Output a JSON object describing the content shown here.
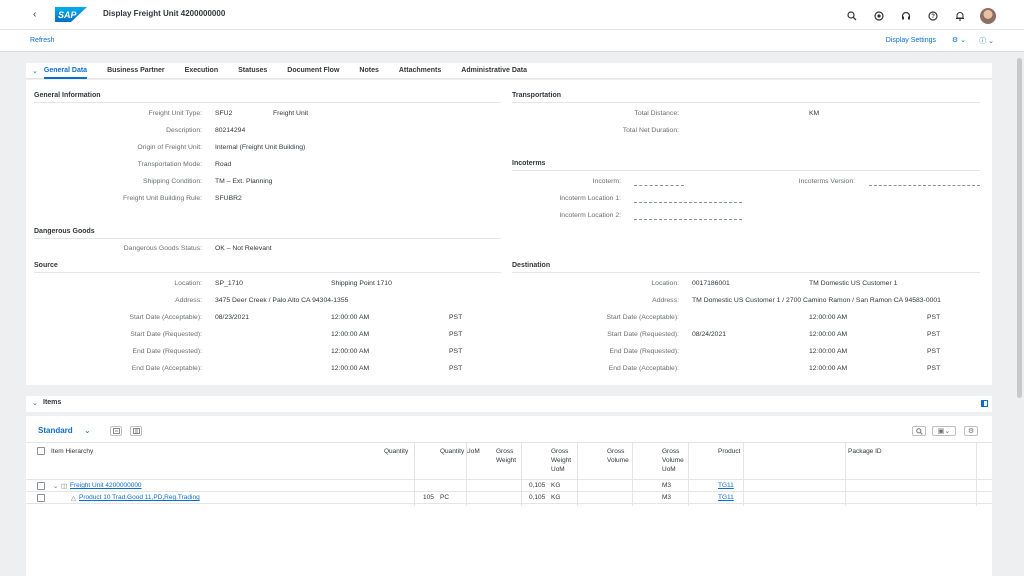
{
  "shell": {
    "title": "Display Freight Unit 4200000000",
    "logo": "SAP",
    "back_icon": "back-icon"
  },
  "subbar": {
    "refresh": "Refresh",
    "display_settings": "Display Settings"
  },
  "tabs": [
    "General Data",
    "Business Partner",
    "Execution",
    "Statuses",
    "Document Flow",
    "Notes",
    "Attachments",
    "Administrative Data"
  ],
  "general": {
    "title": "General Information",
    "rows": [
      {
        "label": "Freight Unit Type:",
        "value": "SFU2",
        "extra": "Freight Unit"
      },
      {
        "label": "Description:",
        "value": "80214294",
        "extra": ""
      },
      {
        "label": "Origin of Freight Unit:",
        "value": "Internal (Freight Unit Building)",
        "extra": ""
      },
      {
        "label": "Transportation Mode:",
        "value": "Road",
        "extra": ""
      },
      {
        "label": "Shipping Condition:",
        "value": "TM – Ext. Planning",
        "extra": ""
      },
      {
        "label": "Freight Unit Building Rule:",
        "value": "SFUBR2",
        "extra": ""
      }
    ]
  },
  "transportation": {
    "title": "Transportation",
    "distance_label": "Total Distance:",
    "distance_unit": "KM",
    "duration_label": "Total Net Duration:"
  },
  "incoterms": {
    "title": "Incoterms",
    "incoterm": "Incoterm:",
    "version": "Incoterms Version:",
    "loc1": "Incoterm Location 1:",
    "loc2": "Incoterm Location 2:"
  },
  "dangerous": {
    "title": "Dangerous Goods",
    "label": "Dangerous Goods Status:",
    "value": "OK – Not Relevant"
  },
  "source": {
    "title": "Source",
    "location_label": "Location:",
    "location": "SP_1710",
    "location_name": "Shipping Point 1710",
    "address_label": "Address:",
    "address": "3475 Deer Creek / Palo Alto CA 94304-1355",
    "dates": [
      {
        "label": "Start Date (Acceptable):",
        "date": "08/23/2021",
        "time": "12:00:00 AM",
        "tz": "PST"
      },
      {
        "label": "Start Date (Requested):",
        "date": "",
        "time": "12:00:00 AM",
        "tz": "PST"
      },
      {
        "label": "End Date (Requested):",
        "date": "",
        "time": "12:00:00 AM",
        "tz": "PST"
      },
      {
        "label": "End Date (Acceptable):",
        "date": "",
        "time": "12:00:00 AM",
        "tz": "PST"
      }
    ]
  },
  "destination": {
    "title": "Destination",
    "location_label": "Location:",
    "location": "0017186001",
    "location_name": "TM Domestic US Customer 1",
    "address_label": "Address:",
    "address": "TM Domestic US Customer 1 / 2700 Camino Ramon / San Ramon CA 94583-0001",
    "dates": [
      {
        "label": "Start Date (Acceptable):",
        "date": "",
        "time": "12:00:00 AM",
        "tz": "PST"
      },
      {
        "label": "Start Date (Requested):",
        "date": "08/24/2021",
        "time": "12:00:00 AM",
        "tz": "PST"
      },
      {
        "label": "End Date (Requested):",
        "date": "",
        "time": "12:00:00 AM",
        "tz": "PST"
      },
      {
        "label": "End Date (Acceptable):",
        "date": "",
        "time": "12:00:00 AM",
        "tz": "PST"
      }
    ]
  },
  "items": {
    "title": "Items",
    "variant": "Standard",
    "columns": {
      "hierarchy": "Item Hierarchy",
      "quantity": "Quantity",
      "qty_uom": "Quantity UoM",
      "gross_weight": "Gross Weight",
      "gross_weight_uom": "Gross Weight UoM",
      "gross_volume": "Gross Volume",
      "gross_volume_uom": "Gross Volume UoM",
      "product": "Product",
      "package": "Package ID"
    },
    "rows": [
      {
        "name": "Freight Unit 4200000000",
        "quantity": "",
        "qty_uom": "",
        "weight": "0,105",
        "weight_uom": "KG",
        "volume": "",
        "volume_uom": "M3",
        "product": "TG11"
      },
      {
        "name": "Product 10 Trad.Good 11,PD,Reg.Trading",
        "quantity": "105",
        "qty_uom": "PC",
        "weight": "0,105",
        "weight_uom": "KG",
        "volume": "",
        "volume_uom": "M3",
        "product": "TG11"
      }
    ]
  }
}
